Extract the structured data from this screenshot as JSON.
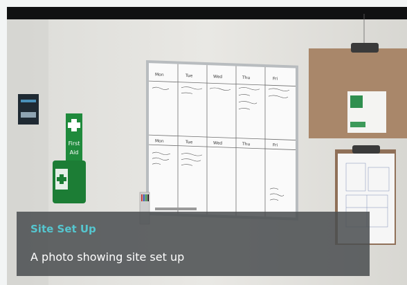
{
  "caption": {
    "title": "Site Set Up",
    "description": "A photo showing site set up"
  },
  "sign": {
    "line1": "First",
    "line2": "Aid"
  },
  "whiteboard": {
    "columns_week1": [
      "Mon",
      "Tue",
      "Wed",
      "Thu",
      "Fri"
    ],
    "columns_week2": [
      "Mon",
      "Tue",
      "Wed",
      "Thu",
      "Fri"
    ]
  },
  "colors": {
    "caption_title": "#55c6cf",
    "caption_bg": "#4b4e50",
    "first_aid_green": "#1f8a3c",
    "clipboard_brown": "#a9876a"
  }
}
